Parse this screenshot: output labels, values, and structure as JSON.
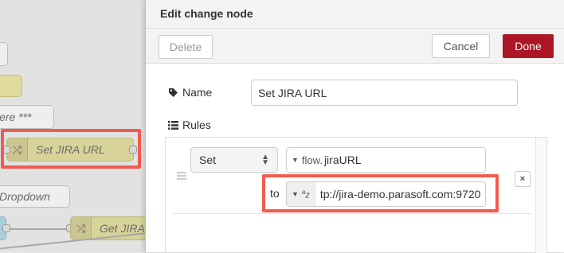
{
  "workspace": {
    "nodes": [
      {
        "label": ""
      },
      {
        "label": ""
      },
      {
        "label": "ere ***"
      },
      {
        "label": "Set JIRA URL",
        "icon": "shuffle-icon"
      },
      {
        "label": "Dropdown"
      },
      {
        "label": "Get JIRA",
        "icon": "shuffle-icon"
      }
    ],
    "highlight_color": "#f25b4f"
  },
  "tray": {
    "title": "Edit change node",
    "delete_label": "Delete",
    "cancel_label": "Cancel",
    "done_label": "Done",
    "done_color": "#ad1625",
    "name_label": "Name",
    "name_value": "Set JIRA URL",
    "rules_label": "Rules",
    "rule": {
      "action": "Set",
      "property_type": "flow.",
      "property_value": "jiraURL",
      "to_label": "to",
      "value_type_icon": "string-az-icon",
      "value": "tp://jira-demo.parasoft.com:9720"
    },
    "remove_label": "×"
  }
}
